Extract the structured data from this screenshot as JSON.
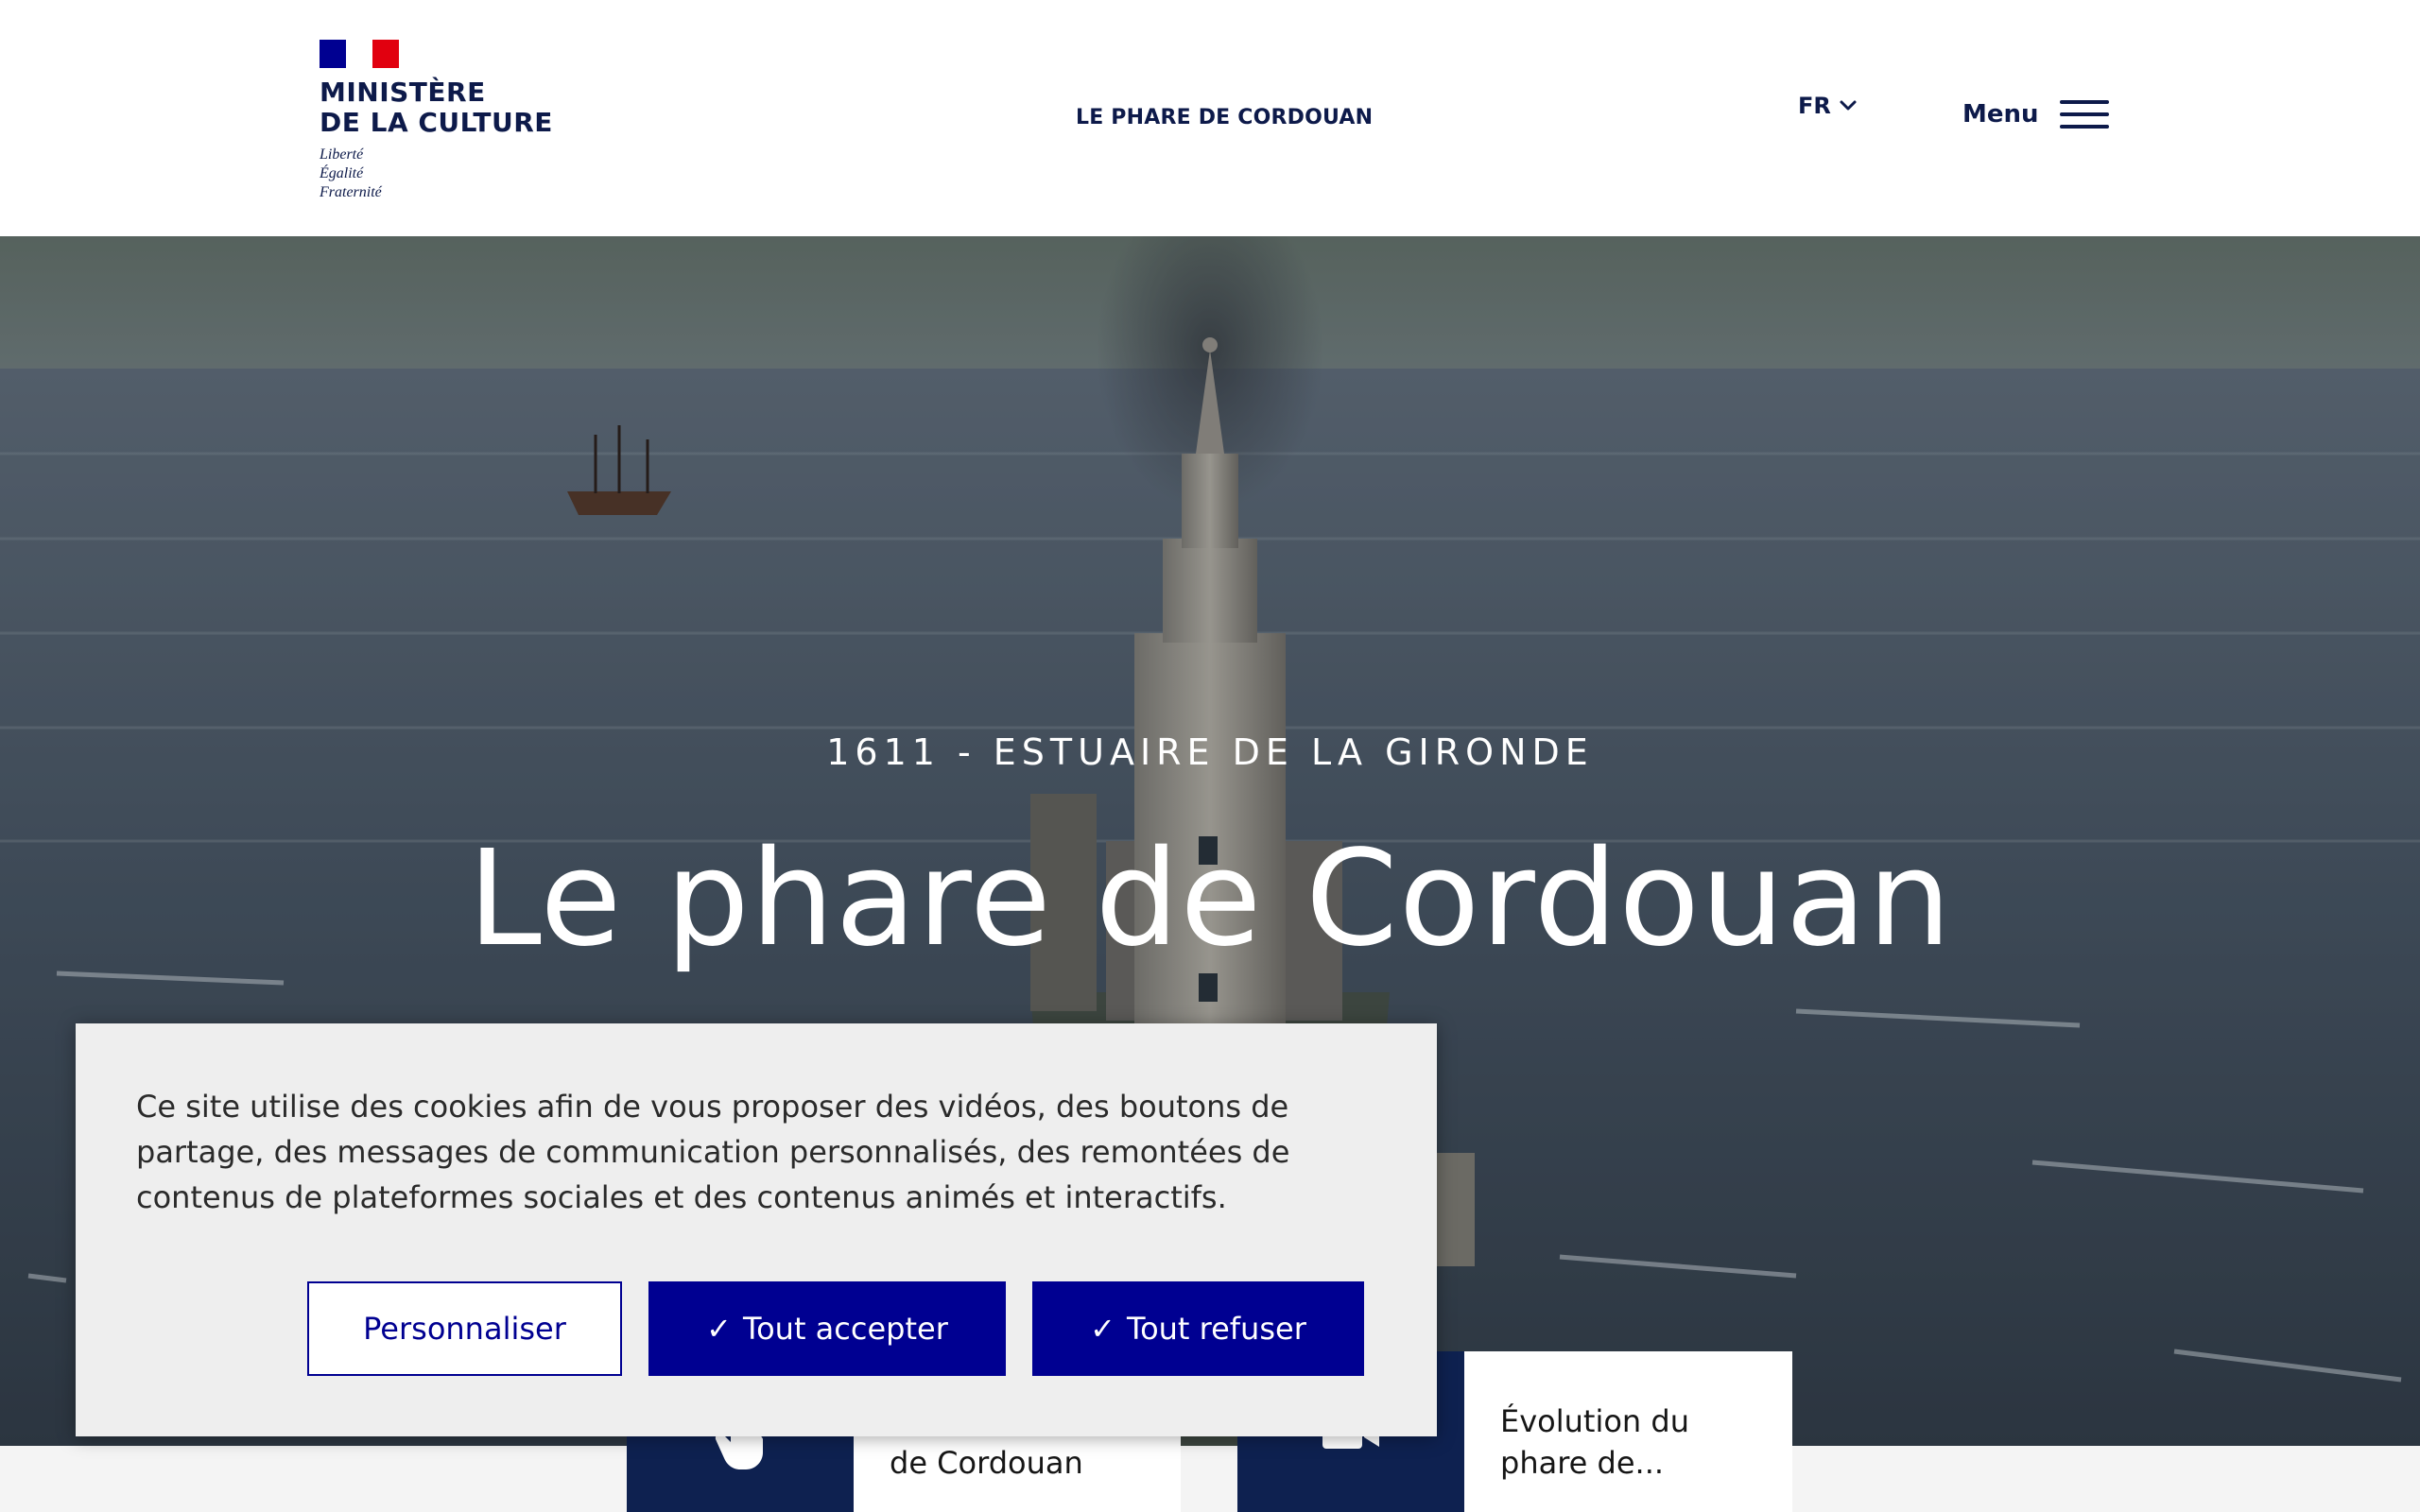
{
  "header": {
    "ministry_line1": "MINISTÈRE",
    "ministry_line2": "DE LA CULTURE",
    "motto": [
      "Liberté",
      "Égalité",
      "Fraternité"
    ],
    "site_name": "LE PHARE DE CORDOUAN",
    "language": "FR",
    "menu_label": "Menu"
  },
  "hero": {
    "kicker": "1611 - ESTUAIRE DE LA GIRONDE",
    "title": "Le phare de Cordouan"
  },
  "cards": [
    {
      "label": "Visite virtuelle de Cordouan",
      "icon": "touch-hand-icon"
    },
    {
      "label": "Évolution du phare de...",
      "icon": "video-camera-icon"
    }
  ],
  "cookie_banner": {
    "text": "Ce site utilise des cookies afin de vous proposer des vidéos, des boutons de partage, des messages de communication personnalisés, des remontées de contenus de plateformes sociales et des contenus animés et interactifs.",
    "customize_label": "Personnaliser",
    "accept_label": "Tout accepter",
    "refuse_label": "Tout refuser",
    "check_glyph": "✓"
  },
  "colors": {
    "brand_blue": "#000091",
    "navy": "#0d1a4a",
    "card_icon_bg": "#0e2150",
    "flag_red": "#e1000f"
  }
}
